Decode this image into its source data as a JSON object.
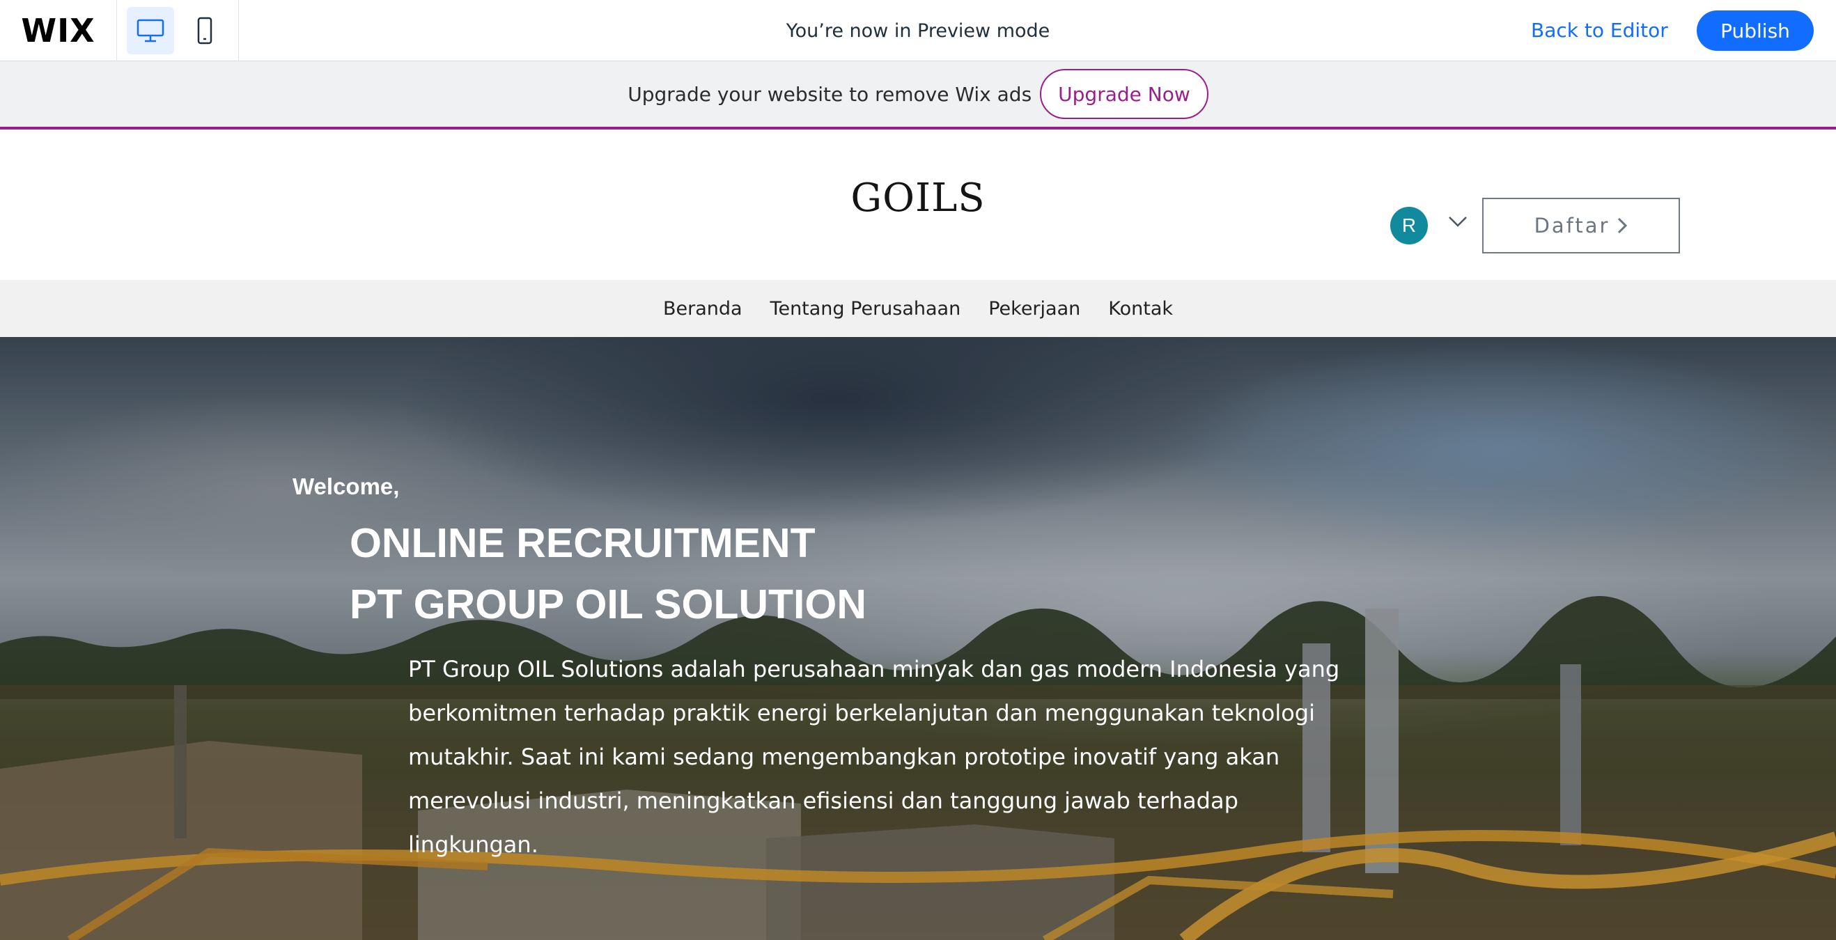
{
  "wix_bar": {
    "logo": "WIX",
    "devices": [
      {
        "name": "desktop-icon",
        "active": true
      },
      {
        "name": "mobile-icon",
        "active": false
      }
    ],
    "preview_text": "You’re now in Preview mode",
    "back_to_editor": "Back to Editor",
    "publish": "Publish"
  },
  "upgrade_banner": {
    "text": "Upgrade your website to remove Wix ads",
    "button": "Upgrade Now"
  },
  "site_header": {
    "title": "GOILS",
    "avatar_initial": "R",
    "signup_button": "Daftar"
  },
  "nav": {
    "items": [
      "Beranda",
      "Tentang Perusahaan",
      "Pekerjaan",
      "Kontak"
    ]
  },
  "hero": {
    "welcome": "Welcome,",
    "title_line1": "ONLINE RECRUITMENT",
    "title_line2": "PT GROUP OIL SOLUTION",
    "description": "PT Group OIL Solutions adalah perusahaan minyak dan gas modern Indonesia yang berkomitmen terhadap praktik energi berkelanjutan dan menggunakan teknologi mutakhir. Saat ini kami sedang mengembangkan prototipe inovatif yang akan merevolusi industri, meningkatkan efisiensi dan tanggung jawab terhadap lingkungan."
  },
  "colors": {
    "wix_blue": "#116dff",
    "upgrade_purple": "#9a1f8b",
    "avatar_teal": "#118a9e"
  }
}
